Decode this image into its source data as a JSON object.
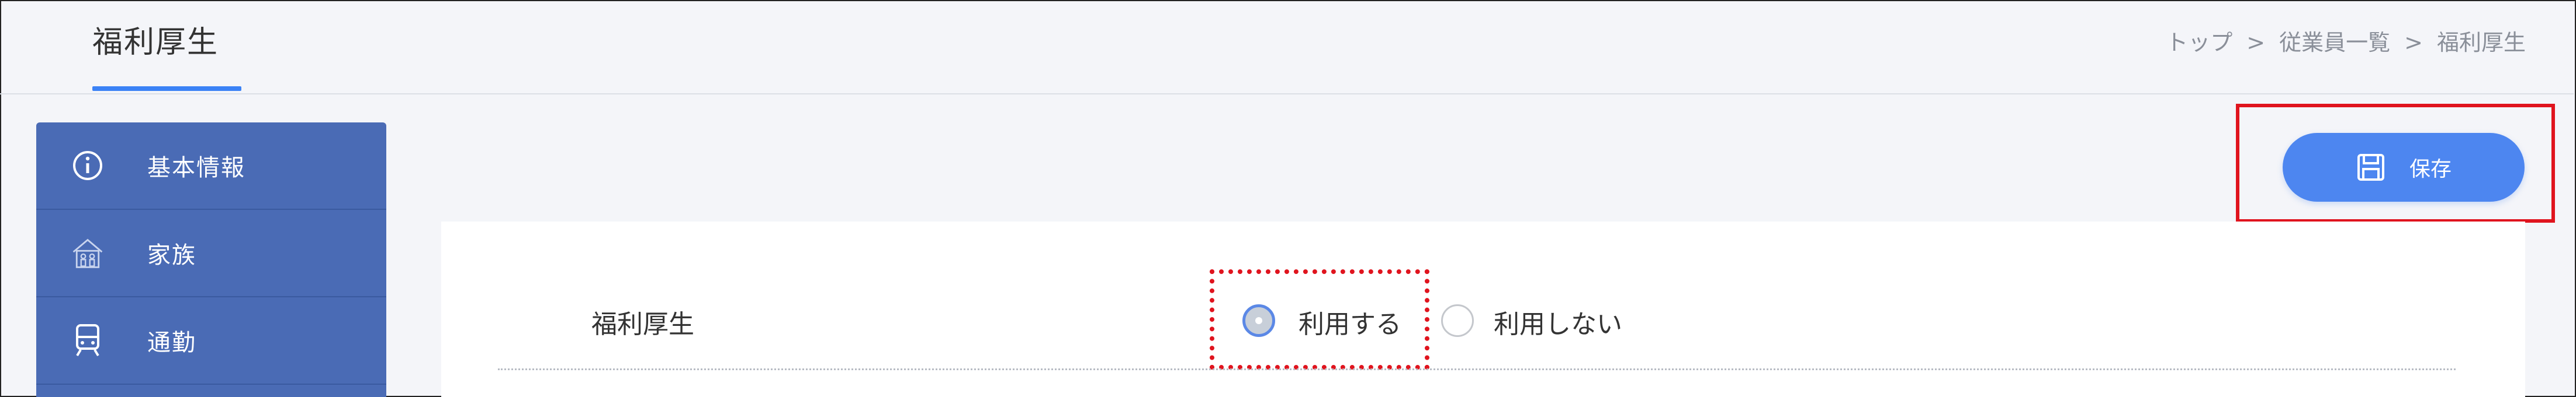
{
  "header": {
    "title": "福利厚生",
    "breadcrumb": [
      "トップ",
      "従業員一覧",
      "福利厚生"
    ],
    "breadcrumb_separator": ">"
  },
  "sidebar": {
    "items": [
      {
        "label": "基本情報",
        "icon": "info-icon"
      },
      {
        "label": "家族",
        "icon": "family-house-icon"
      },
      {
        "label": "通勤",
        "icon": "train-icon"
      }
    ]
  },
  "toolbar": {
    "save_label": "保存",
    "save_icon": "floppy-disk-icon"
  },
  "form": {
    "field_label": "福利厚生",
    "options": [
      {
        "label": "利用する",
        "selected": true
      },
      {
        "label": "利用しない",
        "selected": false
      }
    ]
  },
  "colors": {
    "accent": "#4d86f0",
    "sidebar": "#4a6bb5",
    "highlight": "#e0141e"
  }
}
